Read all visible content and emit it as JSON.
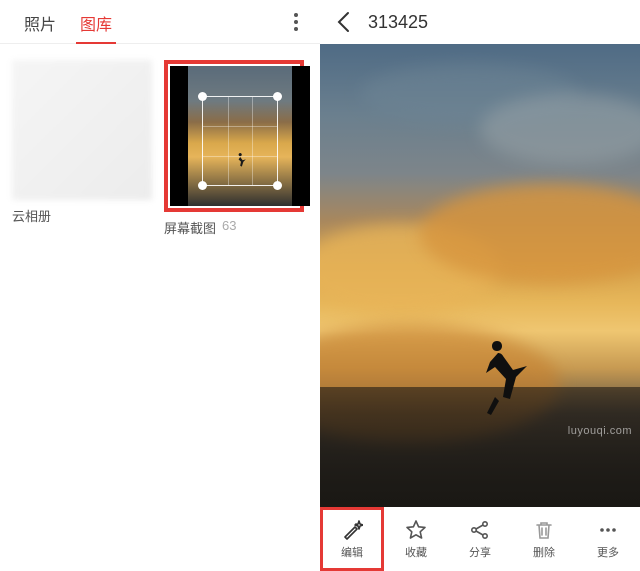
{
  "left": {
    "tabs": {
      "photos": "照片",
      "gallery": "图库"
    },
    "albums": {
      "cloud": {
        "label": "云相册"
      },
      "screenshots": {
        "label": "屏幕截图",
        "count": "63"
      }
    }
  },
  "viewer": {
    "title": "313425",
    "watermark": "luyouqi.com"
  },
  "toolbar": {
    "edit": "编辑",
    "favorite": "收藏",
    "share": "分享",
    "delete": "删除",
    "more": "更多"
  }
}
